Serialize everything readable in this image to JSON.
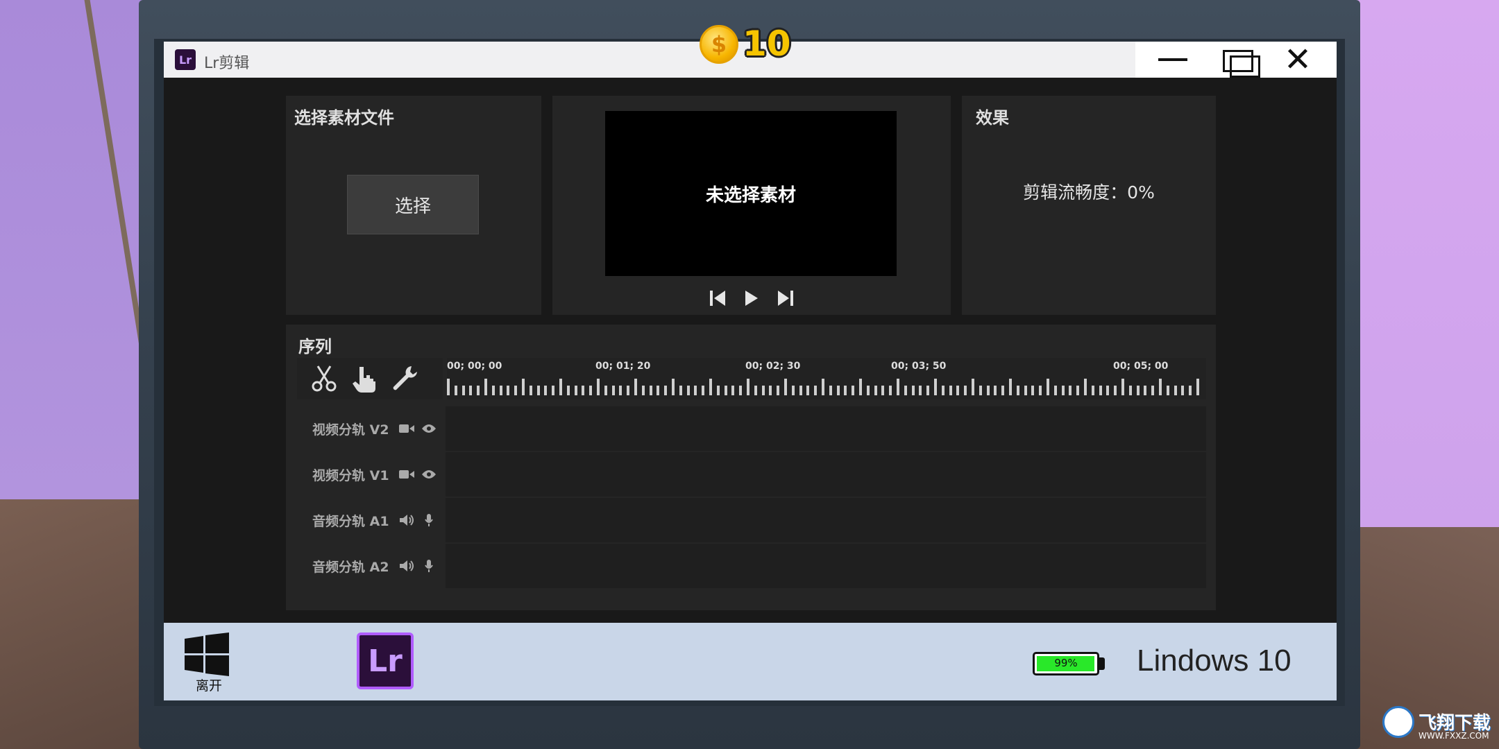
{
  "coin": {
    "symbol": "$",
    "count": "10"
  },
  "window": {
    "logo": "Lr",
    "title": "Lr剪辑"
  },
  "select_panel": {
    "title": "选择素材文件",
    "button": "选择"
  },
  "preview_panel": {
    "screen_text": "未选择素材"
  },
  "effect_panel": {
    "title": "效果",
    "fluency": "剪辑流畅度：0%"
  },
  "sequence": {
    "title": "序列",
    "tools": [
      "scissors-icon",
      "hand-pointer-icon",
      "wrench-icon"
    ],
    "ruler_labels": [
      "00; 00; 00",
      "00; 01; 20",
      "00; 02; 30",
      "00; 03; 50",
      "00; 05; 00"
    ],
    "tracks": [
      {
        "label": "视频分轨 V2",
        "type": "video"
      },
      {
        "label": "视频分轨 V1",
        "type": "video"
      },
      {
        "label": "音频分轨 A1",
        "type": "audio"
      },
      {
        "label": "音频分轨 A2",
        "type": "audio"
      }
    ]
  },
  "taskbar": {
    "start_label": "离开",
    "app_logo": "Lr",
    "battery_percent": "99%",
    "battery_level": 0.99,
    "os_name": "Lindows 10"
  },
  "watermark": {
    "name": "飞翔下载",
    "url": "WWW.FXXZ.COM"
  },
  "colors": {
    "accent": "#b05cff",
    "battery": "#29e829",
    "coin": "#f5c400"
  }
}
